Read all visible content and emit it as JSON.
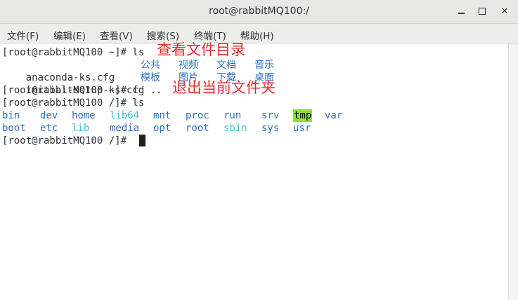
{
  "window": {
    "title": "root@rabbitMQ100:/"
  },
  "menu": [
    "文件(F)",
    "编辑(E)",
    "查看(V)",
    "搜索(S)",
    "终端(T)",
    "帮助(H)"
  ],
  "terminal": {
    "lines": [
      "[root@rabbitMQ100 ~]# ls",
      "anaconda-ks.cfg",
      "initial-setup-ks.cfg",
      "[root@rabbitMQ100 ~]# cd ..",
      "[root@rabbitMQ100 /]# ls",
      "",
      "",
      "[root@rabbitMQ100 /]# "
    ],
    "home_dirs_row1": [
      "公共",
      "视频",
      "文档",
      "音乐"
    ],
    "home_dirs_row2": [
      "模板",
      "图片",
      "下载",
      "桌面"
    ],
    "root_row1": [
      "bin",
      "dev",
      "home",
      "lib64",
      "mnt",
      "proc",
      "run",
      "srv",
      "tmp",
      "var"
    ],
    "root_row2": [
      "boot",
      "etc",
      "lib",
      "media",
      "opt",
      "root",
      "sbin",
      "sys",
      "usr"
    ]
  },
  "annotations": {
    "ls_note": "查看文件目录",
    "cd_note": "退出当前文件夹"
  },
  "colors": {
    "directory": "#2f6fc7",
    "symlink": "#35c2d6",
    "sticky_bg": "#8ae234",
    "annotation": "#ef2929"
  }
}
